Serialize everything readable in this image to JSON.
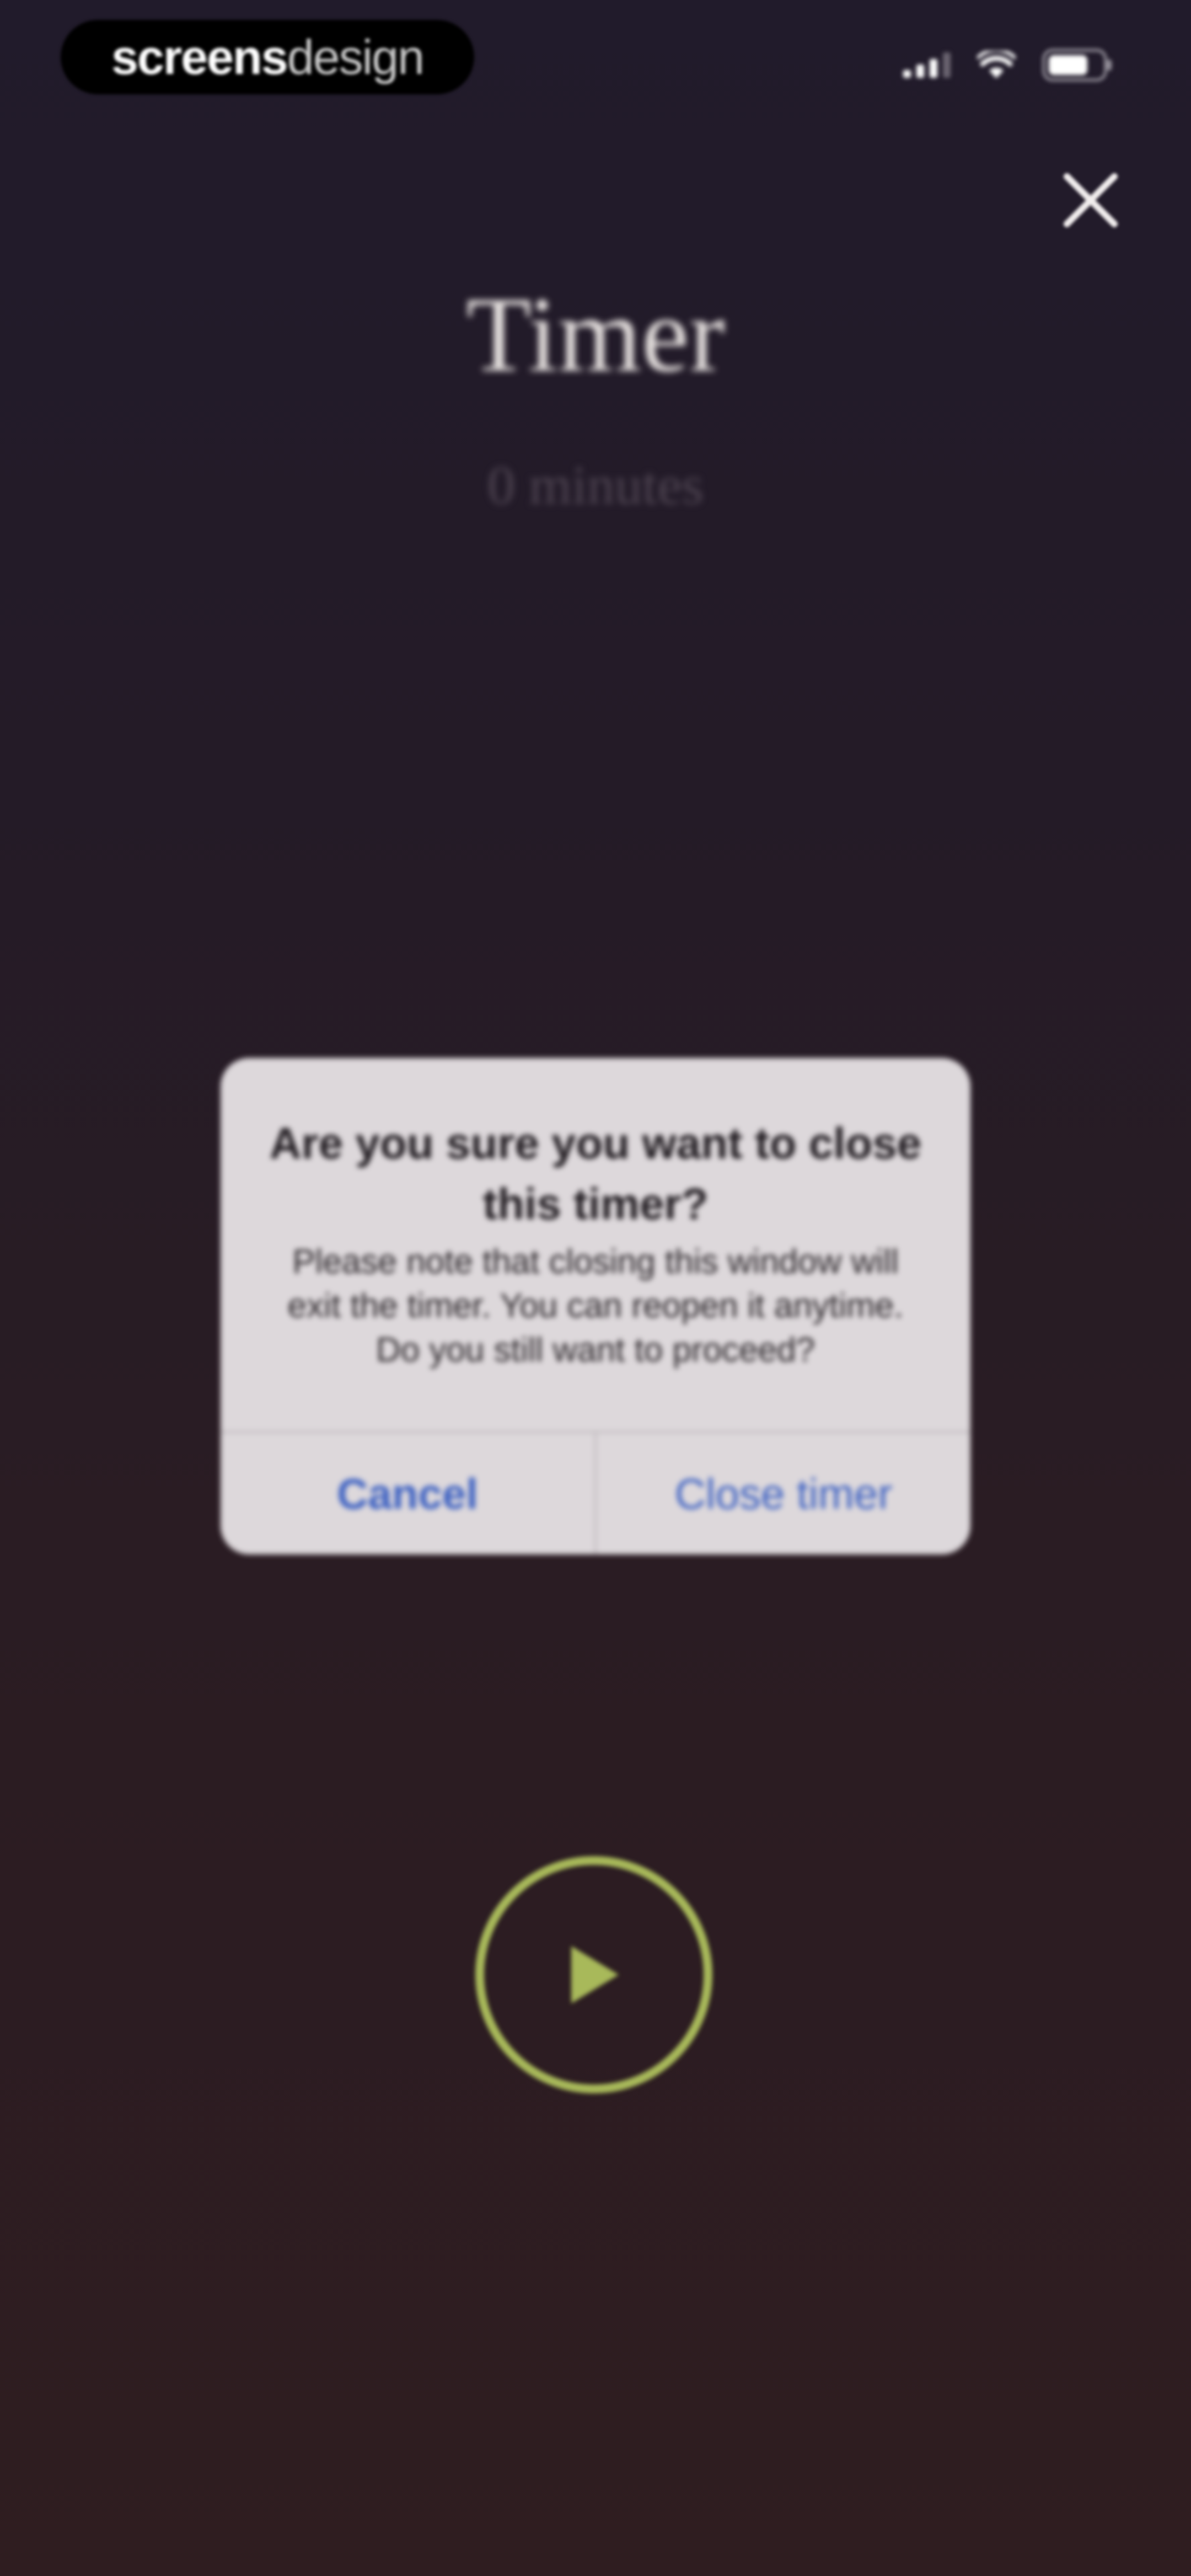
{
  "status_bar": {
    "brand_strong": "screens",
    "brand_light": "design",
    "signal_icon": "cellular-signal-icon",
    "wifi_icon": "wifi-icon",
    "battery_icon": "battery-icon"
  },
  "header": {
    "close_icon": "close-icon",
    "title": "Timer",
    "subtitle": "0 minutes"
  },
  "alert": {
    "title": "Are you sure you want to close this timer?",
    "message": "Please note that closing this window will exit the timer. You can reopen it anytime. Do you still want to proceed?",
    "cancel_label": "Cancel",
    "confirm_label": "Close timer"
  },
  "controls": {
    "play_icon": "play-icon"
  },
  "colors": {
    "accent": "#a8b95a",
    "alert_button": "#3a5fc2",
    "background_top": "#211b2b",
    "background_bottom": "#2f1d20"
  }
}
